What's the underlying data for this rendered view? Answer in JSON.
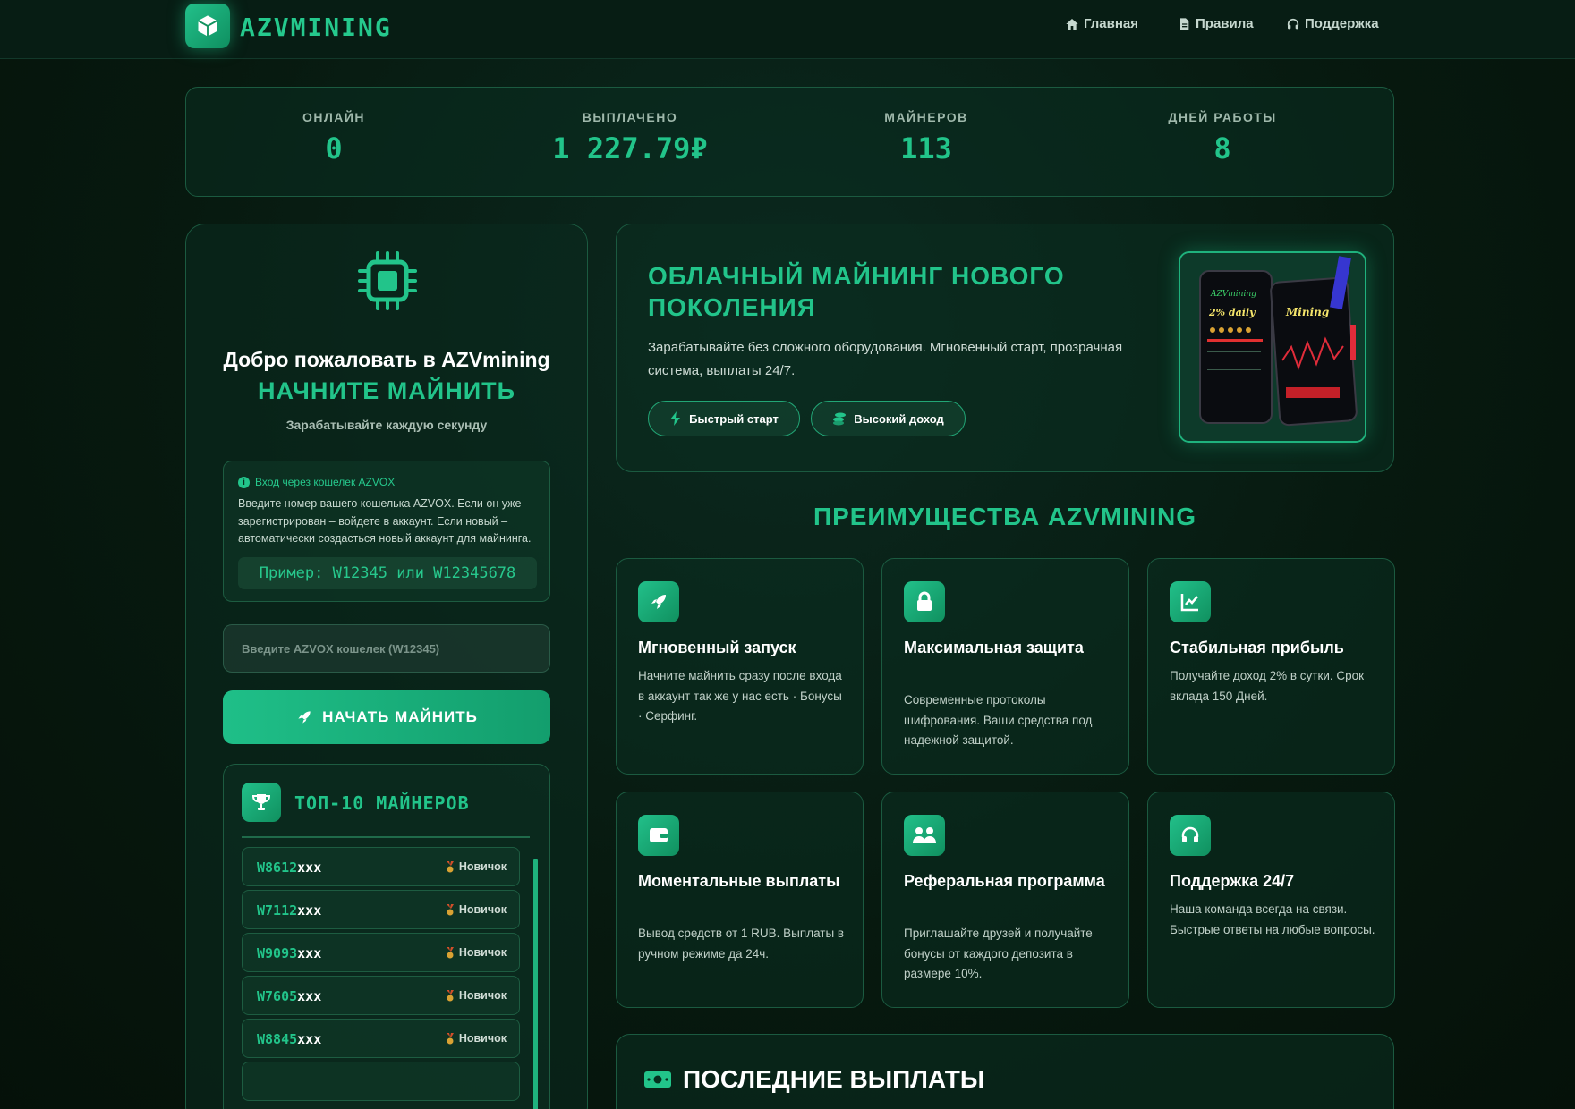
{
  "brand": {
    "name": "AZVMINING"
  },
  "nav": [
    {
      "label": "Главная",
      "icon": "home-icon"
    },
    {
      "label": "Правила",
      "icon": "document-icon"
    },
    {
      "label": "Поддержка",
      "icon": "headset-icon"
    }
  ],
  "stats": [
    {
      "label": "ОНЛАЙН",
      "value": "0"
    },
    {
      "label": "ВЫПЛАЧЕНО",
      "value": "1 227.79₽"
    },
    {
      "label": "МАЙНЕРОВ",
      "value": "113"
    },
    {
      "label": "ДНЕЙ РАБОТЫ",
      "value": "8"
    }
  ],
  "login": {
    "welcome": "Добро пожаловать в AZVmining",
    "start_title": "НАЧНИТЕ МАЙНИТЬ",
    "subtitle": "Зарабатывайте каждую секунду",
    "info_title": "Вход через кошелек AZVOX",
    "info_text": "Введите номер вашего кошелька AZVOX. Если он уже зарегистрирован – войдете в аккаунт. Если новый – автоматически создасться новый аккаунт для майнинга.",
    "example": "Пример: W12345 или W12345678",
    "input_placeholder": "Введите AZVOX кошелек (W12345)",
    "button": "НАЧАТЬ МАЙНИТЬ"
  },
  "top_miners": {
    "title": "ТОП-10 МАЙНЕРОВ",
    "rows": [
      {
        "id_prefix": "W8612",
        "id_suffix": "xxx",
        "rank": "Новичок"
      },
      {
        "id_prefix": "W7112",
        "id_suffix": "xxx",
        "rank": "Новичок"
      },
      {
        "id_prefix": "W9093",
        "id_suffix": "xxx",
        "rank": "Новичок"
      },
      {
        "id_prefix": "W7605",
        "id_suffix": "xxx",
        "rank": "Новичок"
      },
      {
        "id_prefix": "W8845",
        "id_suffix": "xxx",
        "rank": "Новичок"
      }
    ]
  },
  "hero": {
    "title": "ОБЛАЧНЫЙ МАЙНИНГ НОВОГО ПОКОЛЕНИЯ",
    "text": "Зарабатывайте без сложного оборудования. Мгновенный старт, прозрачная система, выплаты 24/7.",
    "pill_fast": "Быстрый старт",
    "pill_income": "Высокий доход",
    "phone_text_1": "AZVmining",
    "phone_text_2": "2% daily",
    "phone_text_3": "Mining"
  },
  "advantages": {
    "title": "ПРЕИМУЩЕСТВА AZVMINING",
    "cards": [
      {
        "icon": "rocket-icon",
        "title": "Мгновенный запуск",
        "text": "Начните майнить сразу после входа в аккаунт так же у нас есть · Бонусы · Серфинг."
      },
      {
        "icon": "lock-icon",
        "title": "Максимальная защита",
        "text": "Современные протоколы шифрования. Ваши средства под надежной защитой."
      },
      {
        "icon": "chart-icon",
        "title": "Стабильная прибыль",
        "text": "Получайте доход 2% в сутки. Срок вклада 150 Дней."
      },
      {
        "icon": "wallet-icon",
        "title": "Моментальные выплаты",
        "text": "Вывод средств от 1 RUB. Выплаты в ручном режиме да 24ч."
      },
      {
        "icon": "users-icon",
        "title": "Реферальная программа",
        "text": "Приглашайте друзей и получайте бонусы от каждого депозита в размере 10%."
      },
      {
        "icon": "headset-icon",
        "title": "Поддержка 24/7",
        "text": "Наша команда всегда на связи. Быстрые ответы на любые вопросы."
      }
    ]
  },
  "payouts": {
    "title": "ПОСЛЕДНИЕ ВЫПЛАТЫ",
    "icon": "money-icon"
  }
}
